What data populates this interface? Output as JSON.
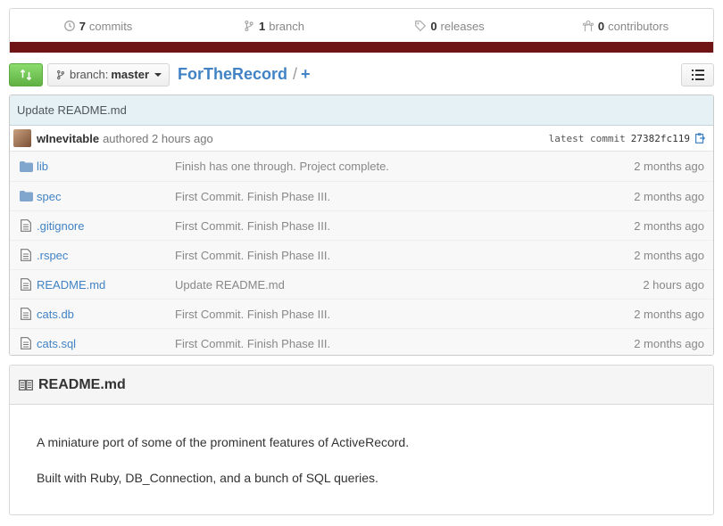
{
  "stats": {
    "commits": {
      "count": "7",
      "label": "commits",
      "icon": "history-icon"
    },
    "branches": {
      "count": "1",
      "label": "branch",
      "icon": "branch-icon"
    },
    "releases": {
      "count": "0",
      "label": "releases",
      "icon": "tag-icon"
    },
    "contributors": {
      "count": "0",
      "label": "contributors",
      "icon": "organization-icon"
    },
    "language_color": "#701516"
  },
  "nav": {
    "branch_label": "branch:",
    "branch_value": "master",
    "repo_name": "ForTheRecord",
    "separator": "/",
    "add_label": "+"
  },
  "commit": {
    "message": "Update README.md",
    "author": "wInevitable",
    "authored_text": "authored 2 hours ago",
    "latest_label": "latest commit",
    "sha": "27382fc119"
  },
  "files": [
    {
      "name": "lib",
      "type": "dir",
      "message": "Finish has one through. Project complete.",
      "age": "2 months ago"
    },
    {
      "name": "spec",
      "type": "dir",
      "message": "First Commit. Finish Phase III.",
      "age": "2 months ago"
    },
    {
      "name": ".gitignore",
      "type": "file",
      "message": "First Commit. Finish Phase III.",
      "age": "2 months ago"
    },
    {
      "name": ".rspec",
      "type": "file",
      "message": "First Commit. Finish Phase III.",
      "age": "2 months ago"
    },
    {
      "name": "README.md",
      "type": "file",
      "message": "Update README.md",
      "age": "2 hours ago"
    },
    {
      "name": "cats.db",
      "type": "file",
      "message": "First Commit. Finish Phase III.",
      "age": "2 months ago"
    },
    {
      "name": "cats.sql",
      "type": "file",
      "message": "First Commit. Finish Phase III.",
      "age": "2 months ago"
    }
  ],
  "readme": {
    "title": "README.md",
    "paragraphs": [
      "A miniature port of some of the prominent features of ActiveRecord.",
      "Built with Ruby, DB_Connection, and a bunch of SQL queries."
    ]
  }
}
